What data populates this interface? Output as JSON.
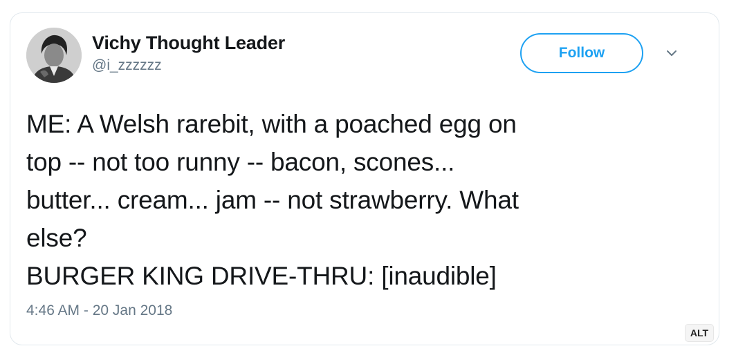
{
  "tweet": {
    "author": {
      "display_name": "Vichy Thought Leader",
      "handle": "@i_zzzzzz"
    },
    "follow_label": "Follow",
    "text_lines": [
      "ME: A Welsh rarebit, with a poached egg on",
      "top -- not too runny -- bacon, scones...",
      "butter... cream... jam -- not strawberry. What",
      "else?",
      "BURGER KING DRIVE-THRU: [inaudible]"
    ],
    "timestamp": "4:46 AM - 20 Jan 2018"
  },
  "overlay": {
    "alt_label": "ALT"
  },
  "colors": {
    "accent": "#1da1f2",
    "secondary_text": "#657786",
    "primary_text": "#14171a",
    "border": "#e1e8ed"
  },
  "icons": {
    "menu": "chevron-down-icon",
    "avatar": "avatar"
  }
}
